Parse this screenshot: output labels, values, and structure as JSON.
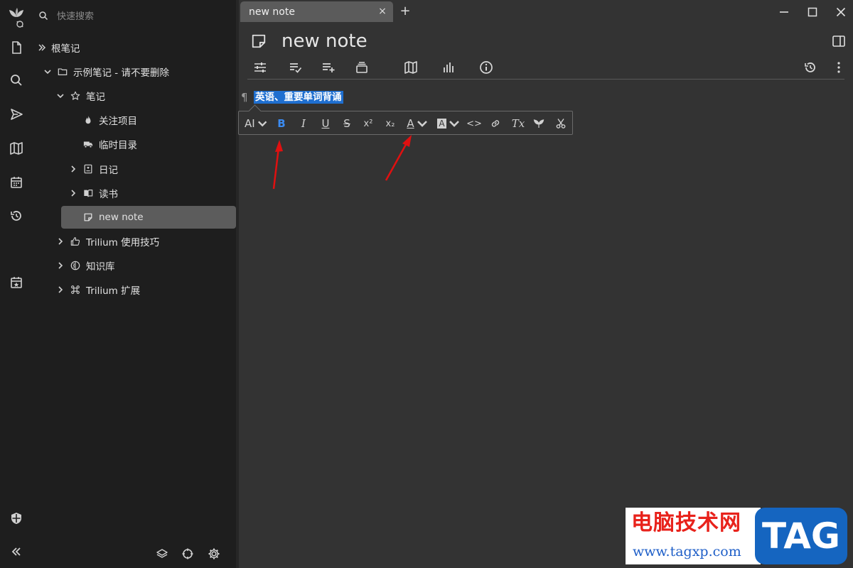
{
  "search": {
    "placeholder": "快速搜索"
  },
  "tree": {
    "root": "根笔记",
    "items": [
      {
        "label": "示例笔记 - 请不要删除"
      },
      {
        "label": "笔记"
      },
      {
        "label": "关注项目"
      },
      {
        "label": "临时目录"
      },
      {
        "label": "日记"
      },
      {
        "label": "读书"
      },
      {
        "label": "new note"
      },
      {
        "label": "Trilium 使用技巧"
      },
      {
        "label": "知识库"
      },
      {
        "label": "Trilium 扩展"
      }
    ]
  },
  "tab": {
    "title": "new note",
    "close": "×",
    "new_tab": "+"
  },
  "note": {
    "title": "new note"
  },
  "editor": {
    "paragraph_mark": "¶",
    "selected_text": "英语、重要单词背诵"
  },
  "toolbar": {
    "heading": "AI",
    "bold": "B",
    "italic": "I",
    "underline": "U",
    "strikethrough": "S",
    "superscript": "x²",
    "subscript": "x₂",
    "font_color": "A",
    "background_color": "A",
    "code": "<>",
    "clear_format": "Tx"
  },
  "colors": {
    "accent_selection": "#1f6fd0",
    "bold_active": "#3b8bf0",
    "annotation_arrow": "#e01010"
  },
  "watermark": {
    "cn": "电脑技术网",
    "url": "www.tagxp.com",
    "tag": "TAG"
  }
}
